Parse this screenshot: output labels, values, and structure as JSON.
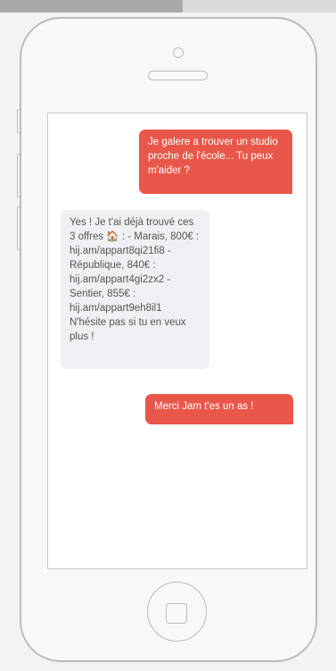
{
  "chat": {
    "messages": [
      {
        "sender": "user",
        "text": "Je galere a trouver un studio proche de l'école... Tu peux m'aider ?"
      },
      {
        "sender": "bot",
        "text": "Yes ! Je t'ai déjà trouvé ces 3 offres 🏠 : - Marais, 800€ : hij.am/appart8qi21fi8 - République, 840€ : hij.am/appart4gi2zx2 - Sentier, 855€ : hij.am/appart9eh8il1\nN'hésite pas si tu en veux plus !"
      },
      {
        "sender": "user",
        "text": "Merci Jam t'es un as !"
      }
    ]
  },
  "colors": {
    "outgoing_bubble": "#e8574a",
    "incoming_bubble": "#eff0f3",
    "device_outline": "#b9bcc0"
  },
  "icons": [
    "camera-icon",
    "speaker-grille",
    "home-button"
  ]
}
